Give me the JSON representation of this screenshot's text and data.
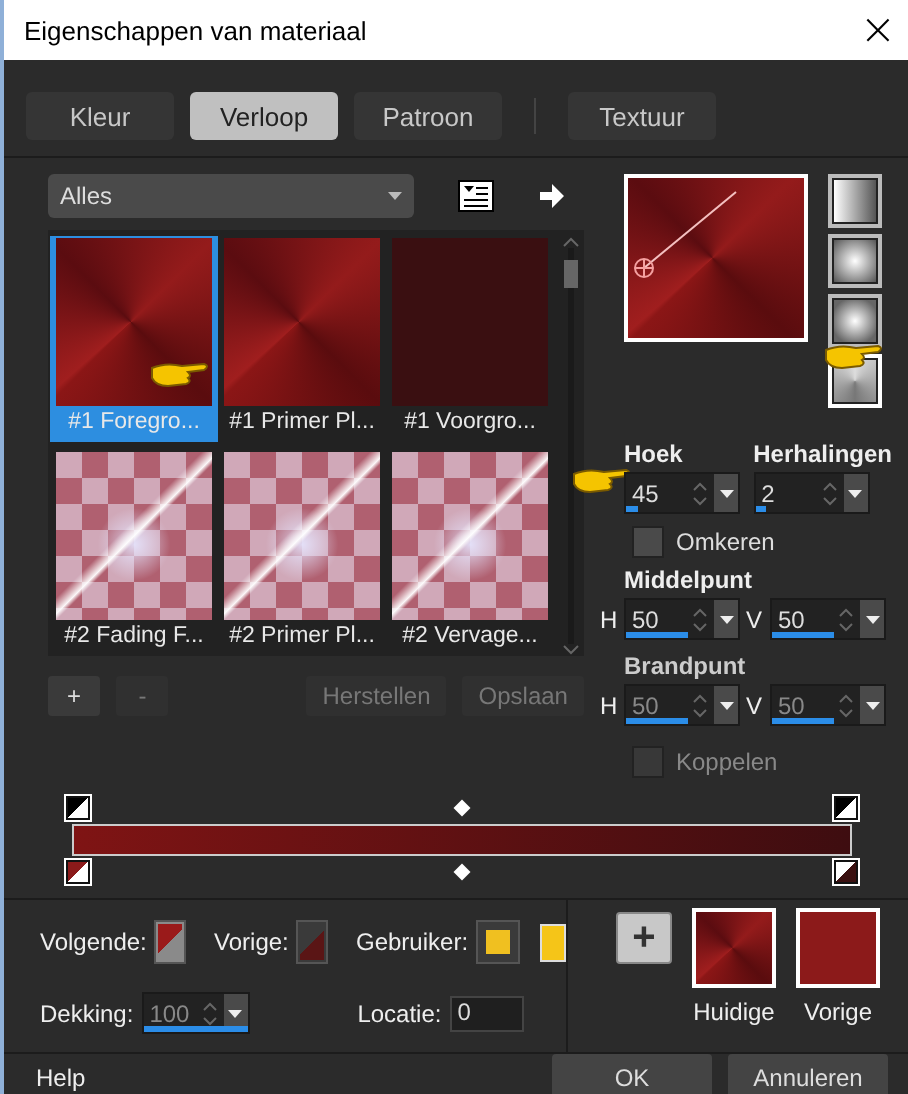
{
  "window": {
    "title": "Eigenschappen van materiaal",
    "close": "×"
  },
  "tabs": [
    {
      "label": "Kleur",
      "selected": false
    },
    {
      "label": "Verloop",
      "selected": true
    },
    {
      "label": "Patroon",
      "selected": false
    },
    {
      "label": "Textuur",
      "selected": false
    }
  ],
  "library": {
    "filter": "Alles",
    "items": [
      {
        "label": "#1 Foregro...",
        "selected": true,
        "kind": "conic"
      },
      {
        "label": "#1 Primer Pl...",
        "selected": false,
        "kind": "conic"
      },
      {
        "label": "#1 Voorgro...",
        "selected": false,
        "kind": "dark"
      },
      {
        "label": "#2 Fading F...",
        "selected": false,
        "kind": "checker"
      },
      {
        "label": "#2 Primer Pl...",
        "selected": false,
        "kind": "checker"
      },
      {
        "label": "#2 Vervage...",
        "selected": false,
        "kind": "checker"
      }
    ]
  },
  "list_buttons": [
    {
      "label": "+",
      "disabled": false
    },
    {
      "label": "-",
      "disabled": true
    },
    {
      "label": "Herstellen",
      "disabled": true
    },
    {
      "label": "Opslaan",
      "disabled": true
    }
  ],
  "styles": [
    {
      "kind": "linear",
      "selected": false
    },
    {
      "kind": "rect",
      "selected": false
    },
    {
      "kind": "radial",
      "selected": false
    },
    {
      "kind": "conic",
      "selected": true
    }
  ],
  "angle": {
    "label": "Hoek",
    "value": "45",
    "level": 0.1
  },
  "repeats": {
    "label": "Herhalingen",
    "value": "2",
    "level": 0.1
  },
  "invert": {
    "label": "Omkeren",
    "checked": false
  },
  "center": {
    "label": "Middelpunt",
    "disabled": false,
    "h": {
      "label": "H",
      "value": "50",
      "level": 0.55
    },
    "v": {
      "label": "V",
      "value": "50",
      "level": 0.55
    }
  },
  "focus": {
    "label": "Brandpunt",
    "disabled": true,
    "h": {
      "label": "H",
      "value": "50",
      "level": 0.55
    },
    "v": {
      "label": "V",
      "value": "50",
      "level": 0.55
    }
  },
  "link": {
    "label": "Koppelen",
    "checked": false,
    "disabled": true
  },
  "next": {
    "label": "Volgende:"
  },
  "previous": {
    "label": "Vorige:"
  },
  "user": {
    "label": "Gebruiker:"
  },
  "opacity": {
    "label": "Dekking:",
    "value": "100",
    "level": 1,
    "disabled": true
  },
  "location": {
    "label": "Locatie:",
    "value": "0"
  },
  "add_swatch": "+",
  "swatches": [
    {
      "label": "Huidige",
      "kind": "conic"
    },
    {
      "label": "Vorige",
      "kind": "solid"
    }
  ],
  "footer": {
    "help": "Help",
    "ok": "OK",
    "cancel": "Annuleren"
  }
}
